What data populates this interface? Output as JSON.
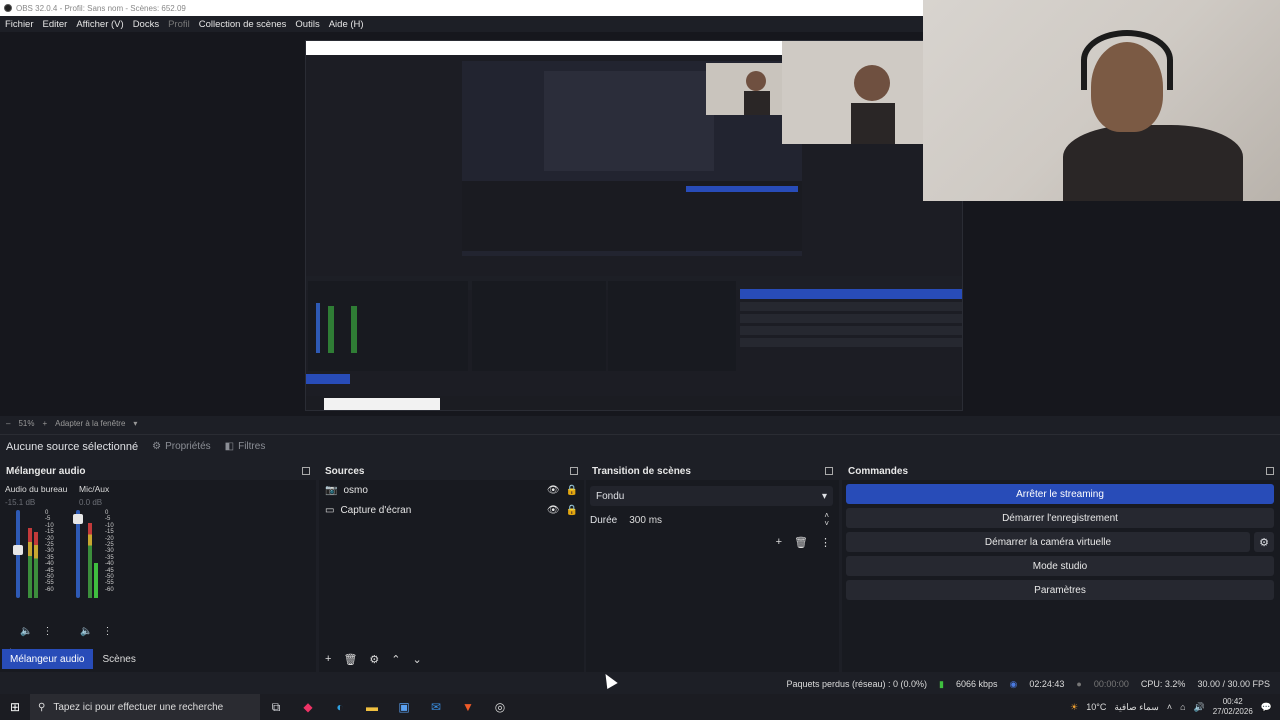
{
  "window": {
    "title": "OBS 32.0.4 - Profil: Sans nom - Scènes: 652.09"
  },
  "menu": [
    "Fichier",
    "Editer",
    "Afficher (V)",
    "Docks",
    "Profil",
    "Collection de scènes",
    "Outils",
    "Aide (H)"
  ],
  "zoom": {
    "level": "51%",
    "fit": "Adapter à la fenêtre"
  },
  "source_toolbar": {
    "none_selected": "Aucune source sélectionné",
    "properties": "Propriétés",
    "filters": "Filtres"
  },
  "mixer": {
    "title": "Mélangeur audio",
    "channels": [
      {
        "name": "Audio du bureau",
        "db": "-15.1 dB",
        "level": 0.55
      },
      {
        "name": "Mic/Aux",
        "db": "0.0 dB",
        "level": 0.95
      }
    ],
    "ticks": [
      "0",
      "-5",
      "-10",
      "-15",
      "-20",
      "-25",
      "-30",
      "-35",
      "-40",
      "-45",
      "-50",
      "-55",
      "-60"
    ]
  },
  "sources": {
    "title": "Sources",
    "items": [
      {
        "name": "osmo",
        "icon": "camera-icon"
      },
      {
        "name": "Capture d'écran",
        "icon": "monitor-icon"
      }
    ]
  },
  "transitions": {
    "title": "Transition de scènes",
    "type": "Fondu",
    "duration_label": "Durée",
    "duration": "300 ms"
  },
  "controls": {
    "title": "Commandes",
    "stop_stream": "Arrêter le streaming",
    "start_record": "Démarrer l'enregistrement",
    "virtual_cam": "Démarrer la caméra virtuelle",
    "studio_mode": "Mode studio",
    "settings": "Paramètres"
  },
  "tabs": {
    "mixer": "Mélangeur audio",
    "scenes": "Scènes"
  },
  "status": {
    "dropped": "Paquets perdus (réseau) : 0 (0.0%)",
    "bitrate": "6066 kbps",
    "stream_time": "02:24:43",
    "rec_time": "00:00:00",
    "cpu": "CPU: 3.2%",
    "fps": "30.00 / 30.00 FPS"
  },
  "taskbar": {
    "search_placeholder": "Tapez ici pour effectuer une recherche",
    "weather": "10°C",
    "weather_desc": "سماء صافية",
    "time": "00:42",
    "date": "27/02/2026"
  }
}
